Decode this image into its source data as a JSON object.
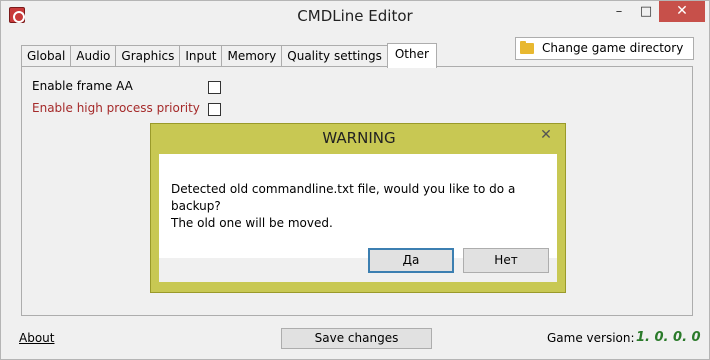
{
  "window": {
    "title": "CMDLine Editor",
    "minimize_label": "–",
    "maximize_label": "□",
    "close_label": "✕"
  },
  "tabs": [
    {
      "label": "Global"
    },
    {
      "label": "Audio"
    },
    {
      "label": "Graphics"
    },
    {
      "label": "Input"
    },
    {
      "label": "Memory"
    },
    {
      "label": "Quality settings"
    },
    {
      "label": "Other",
      "active": true
    }
  ],
  "change_directory": {
    "label": "Change game directory",
    "icon": "folder-icon"
  },
  "options": [
    {
      "label": "Enable frame AA",
      "checked": false,
      "color": "#000000"
    },
    {
      "label": "Enable high process priority",
      "checked": false,
      "color": "#a52a2a"
    }
  ],
  "footer": {
    "about_label": "About",
    "save_label": "Save changes",
    "game_version_label": "Game version:",
    "game_version_value": "1. 0. 0. 0"
  },
  "dialog": {
    "title": "WARNING",
    "close_label": "✕",
    "message_line1": "Detected old commandline.txt file, would you like to do a backup?",
    "message_line2": "The old one will be moved.",
    "yes_label": "Да",
    "no_label": "Нет"
  }
}
